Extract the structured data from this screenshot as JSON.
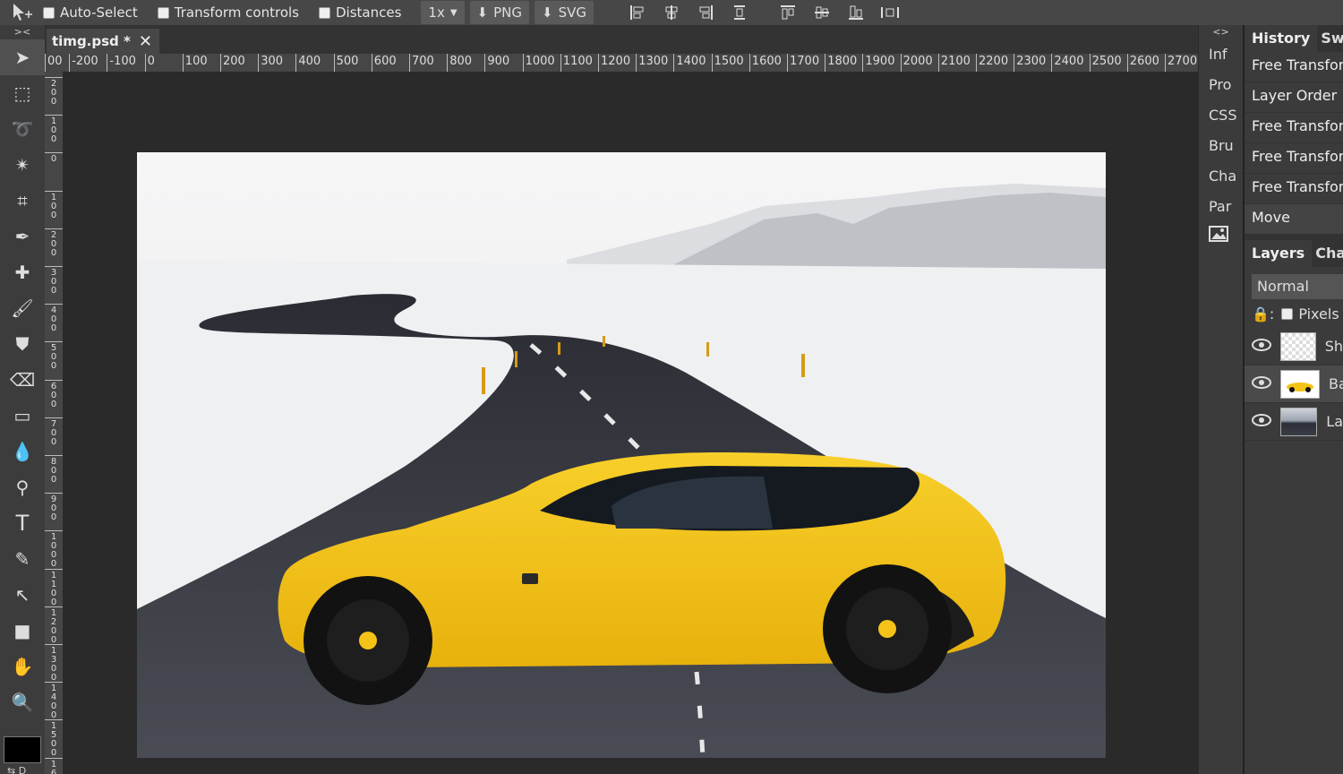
{
  "options_bar": {
    "tool_icon": "move-tool-icon",
    "auto_select_label": "Auto-Select",
    "transform_controls_label": "Transform controls",
    "distances_label": "Distances",
    "scale_value": "1x",
    "png_label": "PNG",
    "svg_label": "SVG"
  },
  "tools": {
    "collapse_label": "><",
    "items": [
      "move-tool-icon",
      "marquee-tool-icon",
      "lasso-tool-icon",
      "magic-wand-icon",
      "crop-tool-icon",
      "eyedropper-icon",
      "healing-brush-icon",
      "brush-tool-icon",
      "clone-stamp-icon",
      "eraser-icon",
      "gradient-tool-icon",
      "blur-tool-icon",
      "dodge-tool-icon",
      "type-tool-icon",
      "pen-tool-icon",
      "path-select-icon",
      "rectangle-tool-icon",
      "hand-tool-icon",
      "zoom-tool-icon"
    ],
    "swap_label": "⇆",
    "default_label": "D",
    "foreground_color": "#000000"
  },
  "document": {
    "tab_title": "timg.psd *"
  },
  "ruler": {
    "h_labels": [
      "00",
      "-200",
      "-100",
      "0",
      "100",
      "200",
      "300",
      "400",
      "500",
      "600",
      "700",
      "800",
      "900",
      "1000",
      "1100",
      "1200",
      "1300",
      "1400",
      "1500",
      "1600",
      "1700",
      "1800",
      "1900",
      "2000",
      "2100",
      "2200",
      "2300",
      "2400",
      "2500",
      "2600",
      "2700"
    ],
    "v_labels": [
      "200",
      "100",
      "0",
      "100",
      "200",
      "300",
      "400",
      "500",
      "600",
      "700",
      "800",
      "900",
      "1000",
      "1100",
      "1200",
      "1300",
      "1400",
      "1500",
      "16"
    ]
  },
  "mini_panel": {
    "collapse_label": "<>",
    "tabs": [
      "Inf",
      "Pro",
      "CSS",
      "Bru",
      "Cha",
      "Par"
    ],
    "image_icon": "image-icon"
  },
  "history_panel": {
    "tab_active": "History",
    "tab_inactive": "Swa",
    "items": [
      "Free Transform",
      "Layer Order",
      "Free Transform",
      "Free Transform",
      "Free Transform",
      "Move"
    ]
  },
  "layers_panel": {
    "tab_active": "Layers",
    "tab_inactive": "Cha",
    "blend_mode": "Normal",
    "lock_label": ":",
    "pixels_label": "Pixels",
    "layers": [
      {
        "name": "Sh",
        "visible": true
      },
      {
        "name": "Ba",
        "visible": true
      },
      {
        "name": "La",
        "visible": true
      }
    ]
  },
  "colors": {
    "accent_yellow": "#f4c317",
    "road": "#35363d",
    "snow": "#f2f2f4"
  }
}
